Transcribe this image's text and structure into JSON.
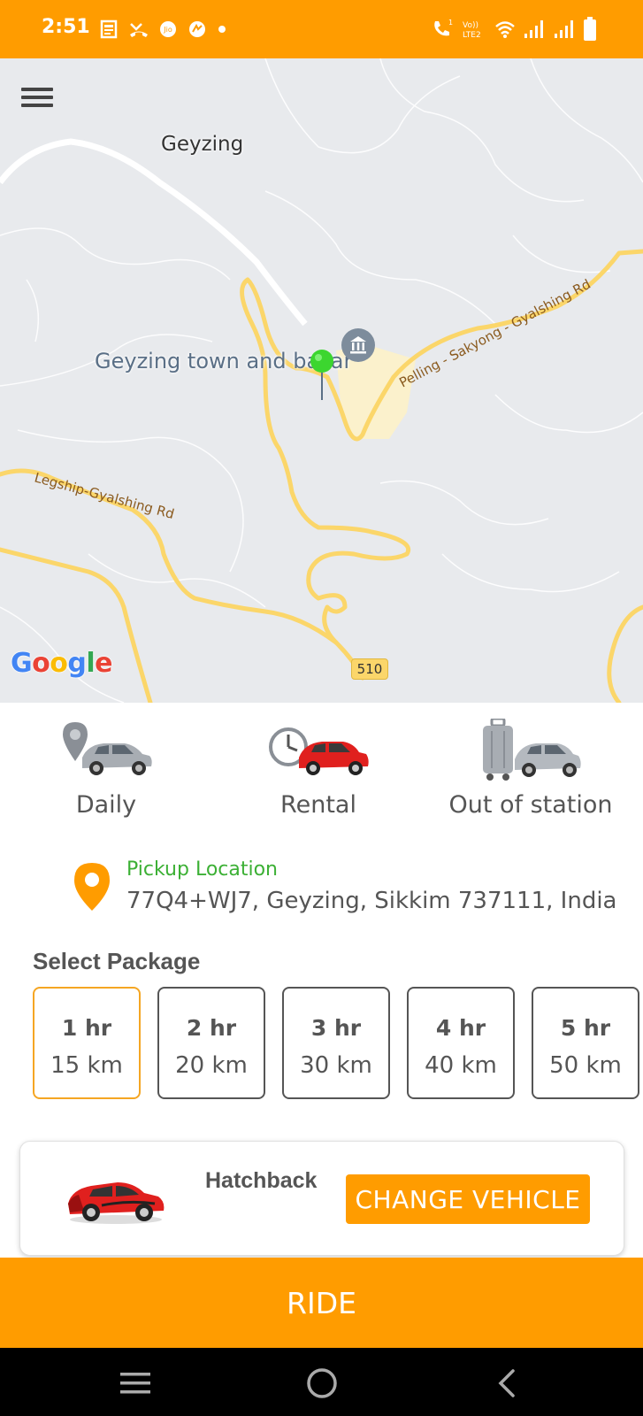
{
  "status_bar": {
    "time": "2:51",
    "icons": [
      "news-icon",
      "missed-call-icon",
      "jio-icon",
      "app-icon",
      "dot-icon",
      "volte-call-icon",
      "lte-icon",
      "wifi-icon",
      "signal-icon",
      "signal-icon",
      "battery-icon"
    ]
  },
  "map": {
    "place_label": "Geyzing",
    "poi_label": "Geyzing town and bazar",
    "road_labels": [
      "Pelling - Sakyong - Gyalshing Rd",
      "Legship-Gyalshing Rd"
    ],
    "road_number": "510",
    "attribution": "Google",
    "logo_colors": [
      "#4285F4",
      "#EA4335",
      "#FBBC05",
      "#4285F4",
      "#34A853",
      "#EA4335"
    ]
  },
  "ride_options": [
    {
      "label": "Daily",
      "icon": "location-car-icon"
    },
    {
      "label": "Rental",
      "icon": "clock-car-icon"
    },
    {
      "label": "Out of station",
      "icon": "luggage-car-icon"
    }
  ],
  "pickup": {
    "label": "Pickup Location",
    "address": "77Q4+WJ7, Geyzing, Sikkim 737111, India",
    "icon": "location-pin-icon"
  },
  "package": {
    "title": "Select Package",
    "options": [
      {
        "hours": "1 hr",
        "km": "15 km",
        "selected": true
      },
      {
        "hours": "2 hr",
        "km": "20 km",
        "selected": false
      },
      {
        "hours": "3 hr",
        "km": "30 km",
        "selected": false
      },
      {
        "hours": "4 hr",
        "km": "40 km",
        "selected": false
      },
      {
        "hours": "5 hr",
        "km": "50 km",
        "selected": false
      }
    ]
  },
  "vehicle": {
    "name": "Hatchback",
    "change_label": "CHANGE VEHICLE",
    "icon": "red-car-icon"
  },
  "ride_label": "RIDE",
  "colors": {
    "accent": "#FF9C00",
    "pickup_label": "#3CB035",
    "selected_border": "#F5A623"
  }
}
